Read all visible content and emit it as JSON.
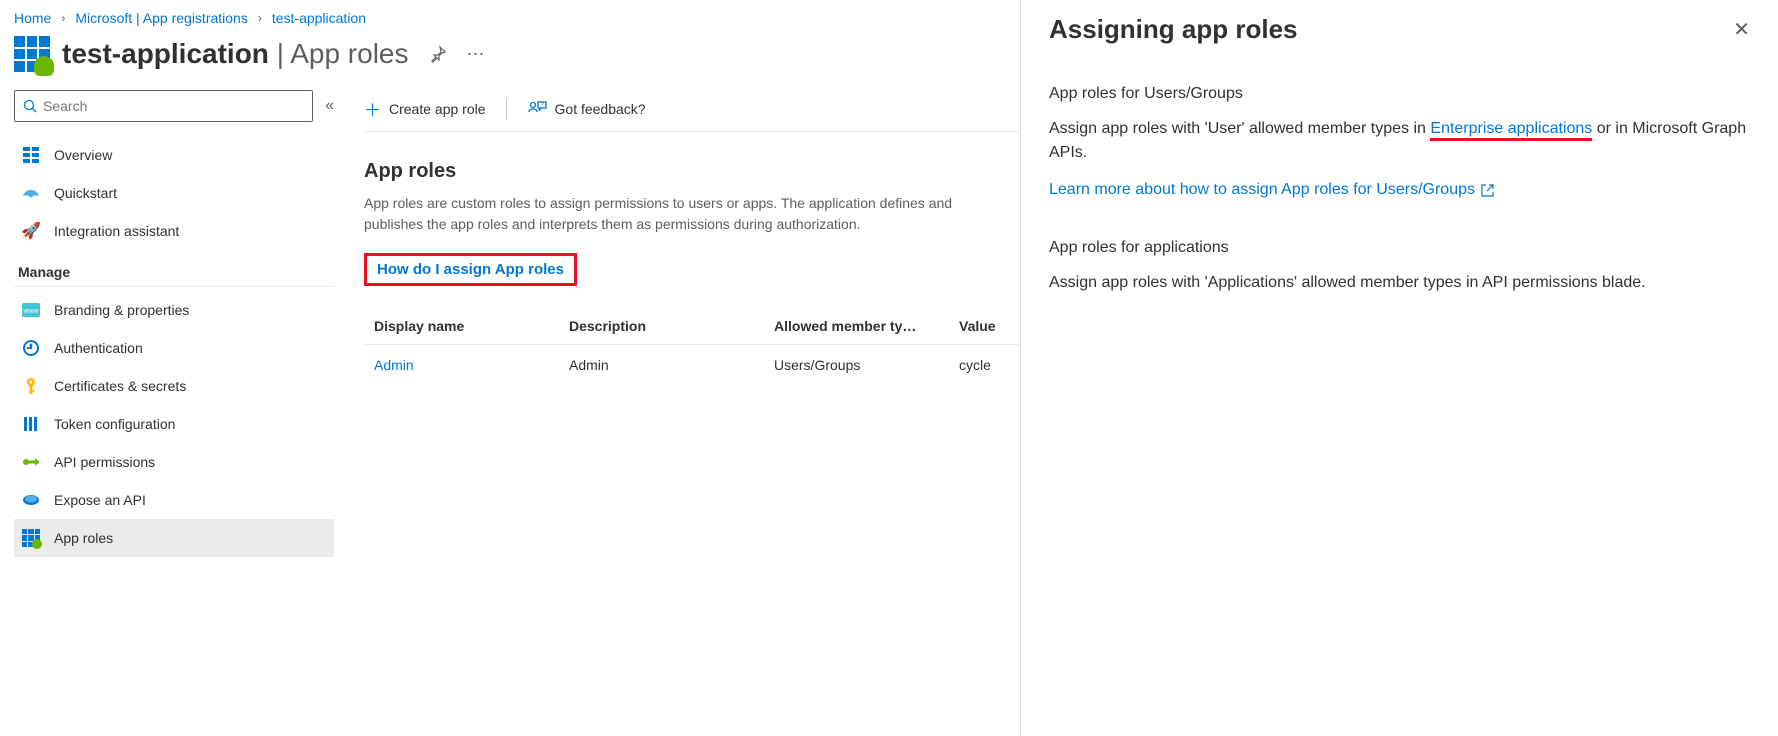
{
  "breadcrumbs": [
    {
      "label": "Home"
    },
    {
      "label": "Microsoft | App registrations"
    },
    {
      "label": "test-application"
    }
  ],
  "page": {
    "app_name": "test-application",
    "title_suffix": " | App roles"
  },
  "sidebar": {
    "search_placeholder": "Search",
    "top_items": [
      {
        "label": "Overview"
      },
      {
        "label": "Quickstart"
      },
      {
        "label": "Integration assistant"
      }
    ],
    "section_label": "Manage",
    "manage_items": [
      {
        "label": "Branding & properties"
      },
      {
        "label": "Authentication"
      },
      {
        "label": "Certificates & secrets"
      },
      {
        "label": "Token configuration"
      },
      {
        "label": "API permissions"
      },
      {
        "label": "Expose an API"
      },
      {
        "label": "App roles"
      }
    ]
  },
  "toolbar": {
    "create": "Create app role",
    "feedback": "Got feedback?"
  },
  "content": {
    "title": "App roles",
    "desc": "App roles are custom roles to assign permissions to users or apps. The application defines and publishes the app roles and interprets them as permissions during authorization.",
    "assign_link": "How do I assign App roles"
  },
  "table": {
    "headers": {
      "display_name": "Display name",
      "description": "Description",
      "allowed": "Allowed member ty…",
      "value": "Value"
    },
    "rows": [
      {
        "display_name": "Admin",
        "description": "Admin",
        "allowed": "Users/Groups",
        "value": "cycle"
      }
    ]
  },
  "panel": {
    "title": "Assigning app roles",
    "sec1_heading": "App roles for Users/Groups",
    "sec1_desc_pre": "Assign app roles with 'User' allowed member types in ",
    "sec1_link": "Enterprise applications",
    "sec1_desc_post": " or in Microsoft Graph APIs.",
    "sec1_learn": "Learn more about how to assign App roles for Users/Groups",
    "sec2_heading": "App roles for applications",
    "sec2_desc": "Assign app roles with 'Applications' allowed member types in API permissions blade."
  }
}
